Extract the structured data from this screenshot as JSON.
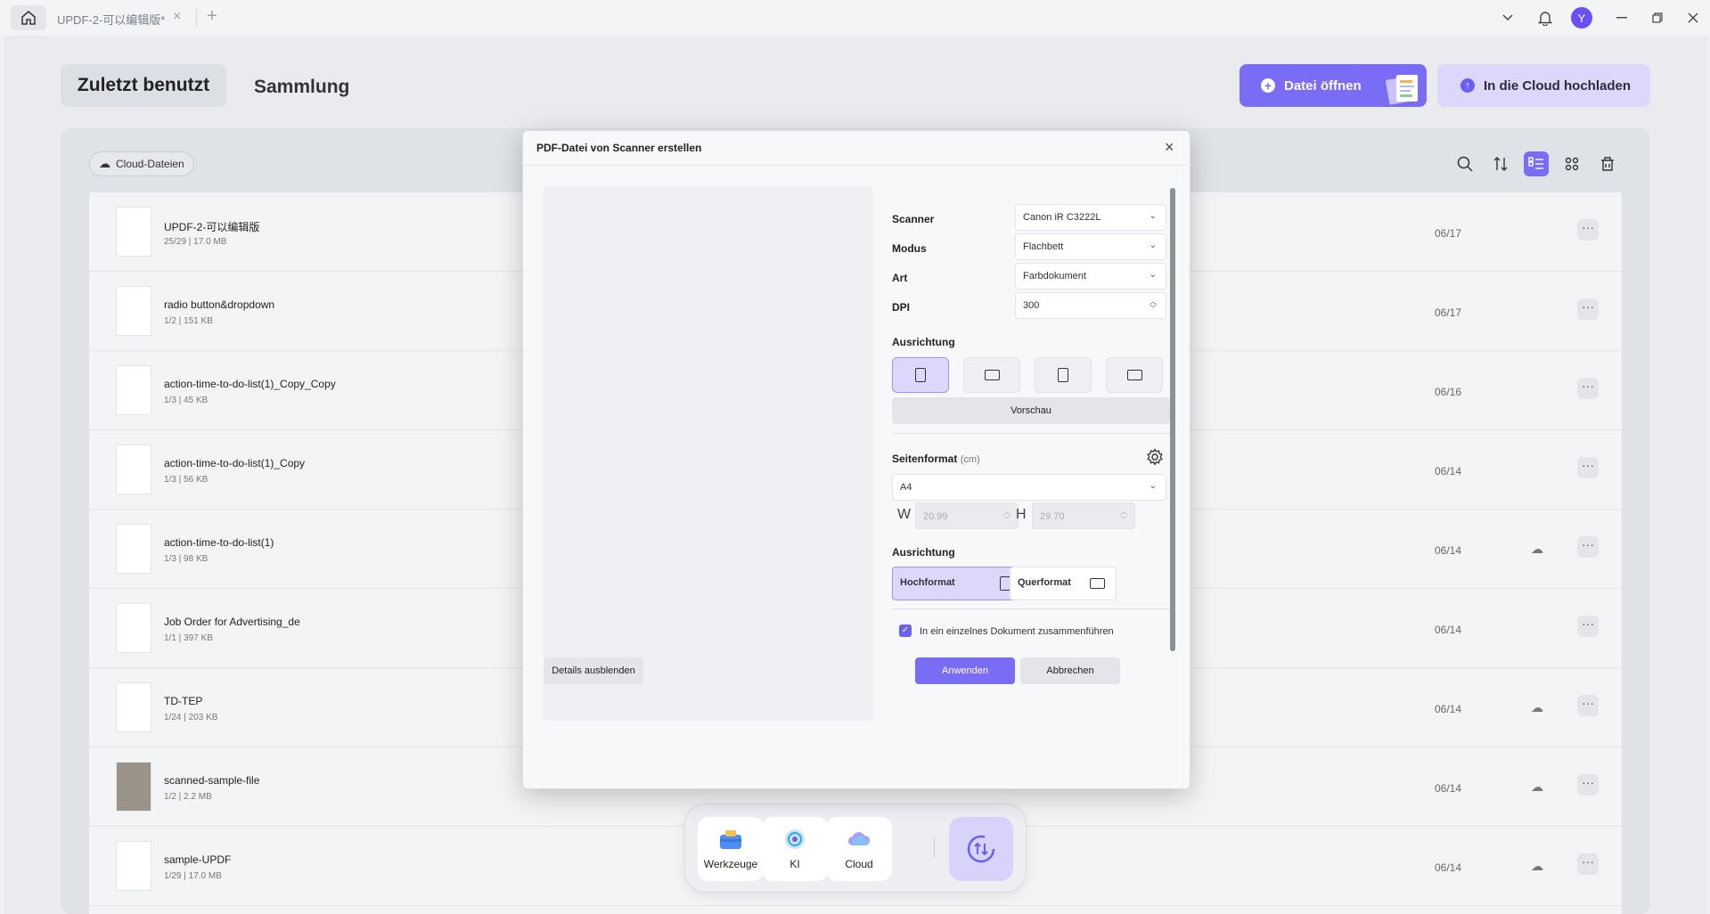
{
  "titlebar": {
    "tab_title": "UPDF-2-可以编辑版*",
    "avatar_letter": "Y"
  },
  "header": {
    "tab_recent": "Zuletzt benutzt",
    "tab_collection": "Sammlung",
    "open_file": "Datei öffnen",
    "upload_cloud": "In die Cloud hochladen"
  },
  "panel": {
    "cloud_chip": "Cloud-Dateien"
  },
  "files": [
    {
      "name": "UPDF-2-可以编辑版",
      "meta": "25/29 | 17.0 MB",
      "date": "06/17",
      "cloud": false
    },
    {
      "name": "radio button&dropdown",
      "meta": "1/2 | 151 KB",
      "date": "06/17",
      "cloud": false
    },
    {
      "name": "action-time-to-do-list(1)_Copy_Copy",
      "meta": "1/3 | 45 KB",
      "date": "06/16",
      "cloud": false
    },
    {
      "name": "action-time-to-do-list(1)_Copy",
      "meta": "1/3 | 56 KB",
      "date": "06/14",
      "cloud": false
    },
    {
      "name": "action-time-to-do-list(1)",
      "meta": "1/3 | 98 KB",
      "date": "06/14",
      "cloud": true
    },
    {
      "name": "Job Order for Advertising_de",
      "meta": "1/1 | 397 KB",
      "date": "06/14",
      "cloud": false
    },
    {
      "name": "TD-TEP",
      "meta": "1/24 | 203 KB",
      "date": "06/14",
      "cloud": true
    },
    {
      "name": "scanned-sample-file",
      "meta": "1/2 | 2.2 MB",
      "date": "06/14",
      "cloud": true
    },
    {
      "name": "sample-UPDF",
      "meta": "1/29 | 17.0 MB",
      "date": "06/14",
      "cloud": true
    }
  ],
  "dock": {
    "tools": "Werkzeuge",
    "ai": "KI",
    "cloud": "Cloud"
  },
  "dialog": {
    "title": "PDF-Datei von Scanner erstellen",
    "scanner_label": "Scanner",
    "scanner_value": "Canon iR C3222L",
    "mode_label": "Modus",
    "mode_value": "Flachbett",
    "type_label": "Art",
    "type_value": "Farbdokument",
    "dpi_label": "DPI",
    "dpi_value": "300",
    "orientation_label": "Ausrichtung",
    "preview_button": "Vorschau",
    "page_format_label": "Seitenformat",
    "page_format_unit": "(cm)",
    "page_format_value": "A4",
    "w_label": "W",
    "w_value": "20.99",
    "h_label": "H",
    "h_value": "29.70",
    "orientation2_label": "Ausrichtung",
    "portrait": "Hochformat",
    "landscape": "Querformat",
    "merge_label": "In ein einzelnes Dokument zusammenführen",
    "merge_checked": true,
    "hide_details": "Details ausblenden",
    "apply": "Anwenden",
    "cancel": "Abbrechen"
  },
  "colors": {
    "accent": "#7b6cf6",
    "accent_light": "#dcd8fb"
  }
}
